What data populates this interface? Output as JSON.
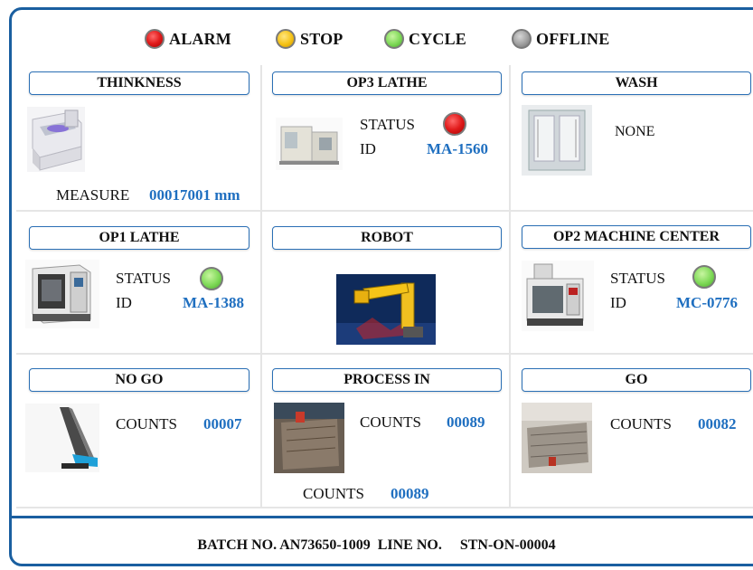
{
  "legend": [
    {
      "label": "ALARM",
      "color": "#e11b1b"
    },
    {
      "label": "STOP",
      "color": "#f5c215"
    },
    {
      "label": "CYCLE",
      "color": "#7ed957"
    },
    {
      "label": "OFFLINE",
      "color": "#a0a0a0"
    }
  ],
  "stations": {
    "thinkness": {
      "title": "THINKNESS",
      "measure_label": "MEASURE",
      "measure_value": "00017001 mm"
    },
    "op3_lathe": {
      "title": "OP3 LATHE",
      "status_label": "STATUS",
      "status_color": "#e11b1b",
      "id_label": "ID",
      "id_value": "MA-1560"
    },
    "wash": {
      "title": "WASH",
      "text": "NONE"
    },
    "op1_lathe": {
      "title": "OP1 LATHE",
      "status_label": "STATUS",
      "status_color": "#7ed957",
      "id_label": "ID",
      "id_value": "MA-1388"
    },
    "robot": {
      "title": "ROBOT"
    },
    "op2_machine_center": {
      "title": "OP2 MACHINE CENTER",
      "status_label": "STATUS",
      "status_color": "#7ed957",
      "id_label": "ID",
      "id_value": "MC-0776"
    },
    "no_go": {
      "title": "NO GO",
      "counts_label": "COUNTS",
      "counts_value": "00007"
    },
    "process_in": {
      "title": "PROCESS IN",
      "counts_label": "COUNTS",
      "counts_value": "00089",
      "counts2_label": "COUNTS",
      "counts2_value": "00089"
    },
    "go": {
      "title": "GO",
      "counts_label": "COUNTS",
      "counts_value": "00082"
    }
  },
  "footer": {
    "batch_label": "BATCH NO.",
    "batch_value": "AN73650-1009",
    "line_label": "LINE NO.",
    "line_value": "STN-ON-00004"
  }
}
